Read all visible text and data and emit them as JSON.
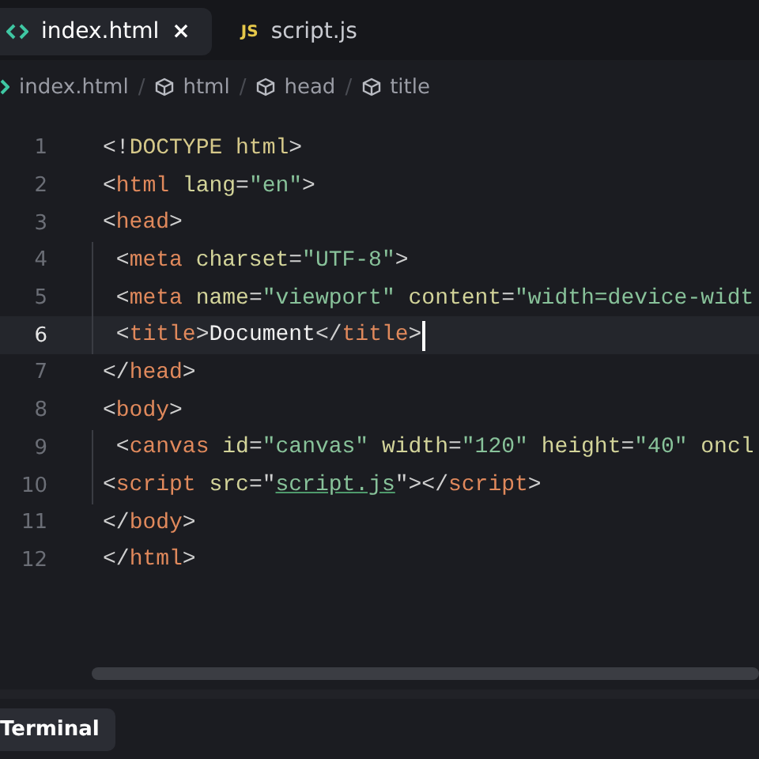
{
  "tabs": [
    {
      "kind": "html",
      "label": "index.html",
      "selected": true,
      "close": "×"
    },
    {
      "kind": "js",
      "icon_label": "JS",
      "label": "script.js",
      "selected": false
    }
  ],
  "breadcrumbs": [
    {
      "kind": "file",
      "label": "index.html"
    },
    {
      "kind": "element",
      "label": "html"
    },
    {
      "kind": "element",
      "label": "head"
    },
    {
      "kind": "element",
      "label": "title"
    }
  ],
  "breadcrumb_separator": "/",
  "editor": {
    "lines": [
      {
        "number": "1",
        "selected": false,
        "guide": false,
        "tokens": [
          {
            "kind": "punct",
            "text": "<!"
          },
          {
            "kind": "doctype",
            "text": "DOCTYPE html"
          },
          {
            "kind": "punct",
            "text": ">"
          }
        ]
      },
      {
        "number": "2",
        "selected": false,
        "guide": false,
        "tokens": [
          {
            "kind": "punct",
            "text": "<"
          },
          {
            "kind": "tag",
            "text": "html"
          },
          {
            "kind": "attr",
            "text": " lang"
          },
          {
            "kind": "punct",
            "text": "="
          },
          {
            "kind": "string",
            "text": "\"en\""
          },
          {
            "kind": "punct",
            "text": ">"
          }
        ]
      },
      {
        "number": "3",
        "selected": false,
        "guide": false,
        "tokens": [
          {
            "kind": "punct",
            "text": "<"
          },
          {
            "kind": "tag",
            "text": "head"
          },
          {
            "kind": "punct",
            "text": ">"
          }
        ]
      },
      {
        "number": "4",
        "selected": false,
        "guide": true,
        "tokens": [
          {
            "kind": "punct",
            "text": " <"
          },
          {
            "kind": "tag",
            "text": "meta"
          },
          {
            "kind": "attr",
            "text": " charset"
          },
          {
            "kind": "punct",
            "text": "="
          },
          {
            "kind": "string",
            "text": "\"UTF-8\""
          },
          {
            "kind": "punct",
            "text": ">"
          }
        ]
      },
      {
        "number": "5",
        "selected": false,
        "guide": true,
        "tokens": [
          {
            "kind": "punct",
            "text": " <"
          },
          {
            "kind": "tag",
            "text": "meta"
          },
          {
            "kind": "attr",
            "text": " name"
          },
          {
            "kind": "punct",
            "text": "="
          },
          {
            "kind": "string",
            "text": "\"viewport\""
          },
          {
            "kind": "attr",
            "text": " content"
          },
          {
            "kind": "punct",
            "text": "="
          },
          {
            "kind": "string",
            "text": "\"width=device-widt"
          }
        ]
      },
      {
        "number": "6",
        "selected": true,
        "guide": true,
        "tokens": [
          {
            "kind": "punct",
            "text": " <"
          },
          {
            "kind": "tag",
            "text": "title"
          },
          {
            "kind": "punct",
            "text": ">"
          },
          {
            "kind": "text",
            "text": "Document"
          },
          {
            "kind": "punct",
            "text": "</"
          },
          {
            "kind": "tag",
            "text": "title"
          },
          {
            "kind": "punct",
            "text": ">"
          }
        ]
      },
      {
        "number": "7",
        "selected": false,
        "guide": false,
        "tokens": [
          {
            "kind": "punct",
            "text": "</"
          },
          {
            "kind": "tag",
            "text": "head"
          },
          {
            "kind": "punct",
            "text": ">"
          }
        ]
      },
      {
        "number": "8",
        "selected": false,
        "guide": false,
        "tokens": [
          {
            "kind": "punct",
            "text": "<"
          },
          {
            "kind": "tag",
            "text": "body"
          },
          {
            "kind": "punct",
            "text": ">"
          }
        ]
      },
      {
        "number": "9",
        "selected": false,
        "guide": true,
        "tokens": [
          {
            "kind": "punct",
            "text": " <"
          },
          {
            "kind": "tag",
            "text": "canvas"
          },
          {
            "kind": "attr",
            "text": " id"
          },
          {
            "kind": "punct",
            "text": "="
          },
          {
            "kind": "string",
            "text": "\"canvas\""
          },
          {
            "kind": "attr",
            "text": " width"
          },
          {
            "kind": "punct",
            "text": "="
          },
          {
            "kind": "string",
            "text": "\"120\""
          },
          {
            "kind": "attr",
            "text": " height"
          },
          {
            "kind": "punct",
            "text": "="
          },
          {
            "kind": "string",
            "text": "\"40\""
          },
          {
            "kind": "attr",
            "text": " oncl"
          }
        ]
      },
      {
        "number": "10",
        "selected": false,
        "guide": true,
        "tokens": [
          {
            "kind": "punct",
            "text": "<"
          },
          {
            "kind": "tag",
            "text": "script"
          },
          {
            "kind": "attr",
            "text": " src"
          },
          {
            "kind": "punct",
            "text": "=\""
          },
          {
            "kind": "link",
            "text": "script.js"
          },
          {
            "kind": "punct",
            "text": "\"></"
          },
          {
            "kind": "tag",
            "text": "script"
          },
          {
            "kind": "punct",
            "text": ">"
          }
        ]
      },
      {
        "number": "11",
        "selected": false,
        "guide": false,
        "tokens": [
          {
            "kind": "punct",
            "text": "</"
          },
          {
            "kind": "tag",
            "text": "body"
          },
          {
            "kind": "punct",
            "text": ">"
          }
        ]
      },
      {
        "number": "12",
        "selected": false,
        "guide": false,
        "tokens": [
          {
            "kind": "punct",
            "text": "</"
          },
          {
            "kind": "tag",
            "text": "html"
          },
          {
            "kind": "punct",
            "text": ">"
          }
        ]
      }
    ]
  },
  "panel_tabs": [
    {
      "label": "Terminal",
      "selected": true
    }
  ]
}
